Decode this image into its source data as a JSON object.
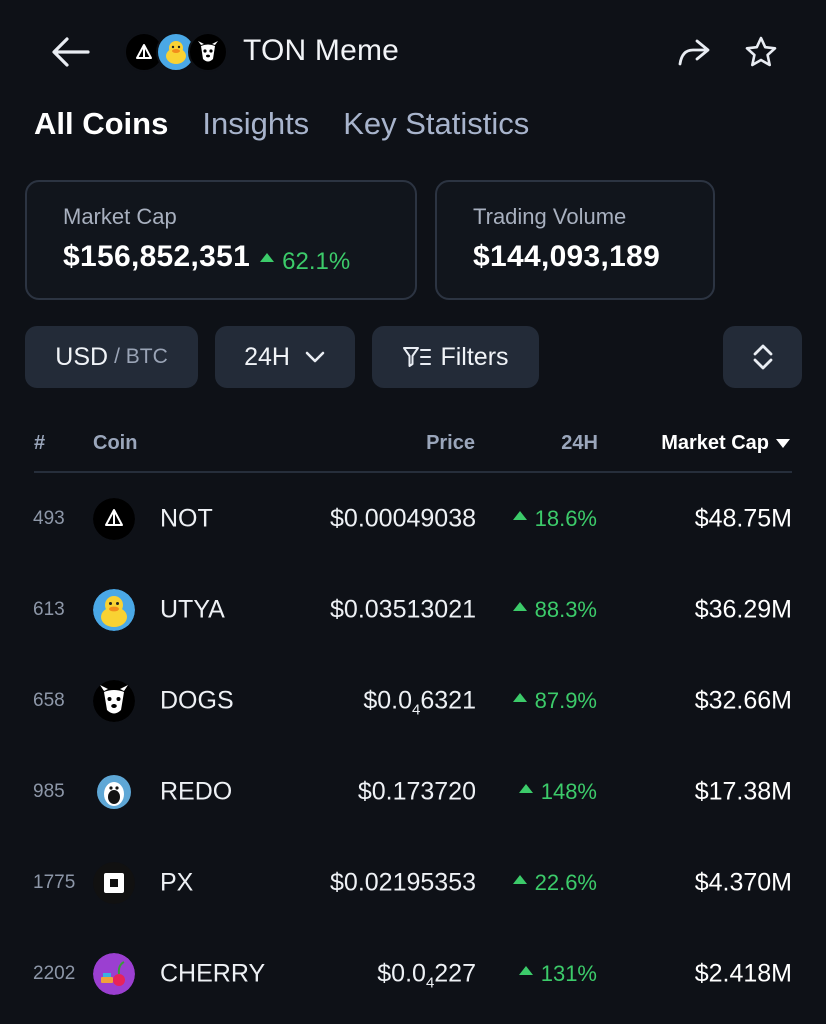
{
  "header": {
    "title": "TON Meme",
    "logos": [
      "not-logo-icon",
      "utya-logo-icon",
      "dogs-logo-icon"
    ]
  },
  "tabs": [
    {
      "label": "All Coins",
      "active": true
    },
    {
      "label": "Insights",
      "active": false
    },
    {
      "label": "Key Statistics",
      "active": false
    }
  ],
  "stats": {
    "market_cap": {
      "label": "Market Cap",
      "value": "$156,852,351",
      "change": "62.1%"
    },
    "trading_volume": {
      "label": "Trading Volume",
      "value": "$144,093,189"
    }
  },
  "filters": {
    "currency_primary": "USD",
    "currency_secondary": "/ BTC",
    "period": "24H",
    "filters_label": "Filters"
  },
  "table": {
    "columns": {
      "rank": "#",
      "coin": "Coin",
      "price": "Price",
      "change": "24H",
      "market_cap": "Market Cap"
    },
    "rows": [
      {
        "rank": "493",
        "name": "NOT",
        "price": "$0.00049038",
        "price_pre": "",
        "price_sub": "",
        "price_post": "",
        "change": "18.6%",
        "market_cap": "$48.75M",
        "icon": "not-icon"
      },
      {
        "rank": "613",
        "name": "UTYA",
        "price": "$0.03513021",
        "price_pre": "",
        "price_sub": "",
        "price_post": "",
        "change": "88.3%",
        "market_cap": "$36.29M",
        "icon": "utya-icon"
      },
      {
        "rank": "658",
        "name": "DOGS",
        "price": "",
        "price_pre": "$0.0",
        "price_sub": "4",
        "price_post": "6321",
        "change": "87.9%",
        "market_cap": "$32.66M",
        "icon": "dogs-icon"
      },
      {
        "rank": "985",
        "name": "REDO",
        "price": "$0.173720",
        "price_pre": "",
        "price_sub": "",
        "price_post": "",
        "change": "148%",
        "market_cap": "$17.38M",
        "icon": "redo-icon"
      },
      {
        "rank": "1775",
        "name": "PX",
        "price": "$0.02195353",
        "price_pre": "",
        "price_sub": "",
        "price_post": "",
        "change": "22.6%",
        "market_cap": "$4.370M",
        "icon": "px-icon"
      },
      {
        "rank": "2202",
        "name": "CHERRY",
        "price": "",
        "price_pre": "$0.0",
        "price_sub": "4",
        "price_post": "227",
        "change": "131%",
        "market_cap": "$2.418M",
        "icon": "cherry-icon"
      }
    ]
  },
  "colors": {
    "background": "#0e1117",
    "positive": "#3ccb6a",
    "pill": "#232b38",
    "card_border": "#2c3442"
  }
}
